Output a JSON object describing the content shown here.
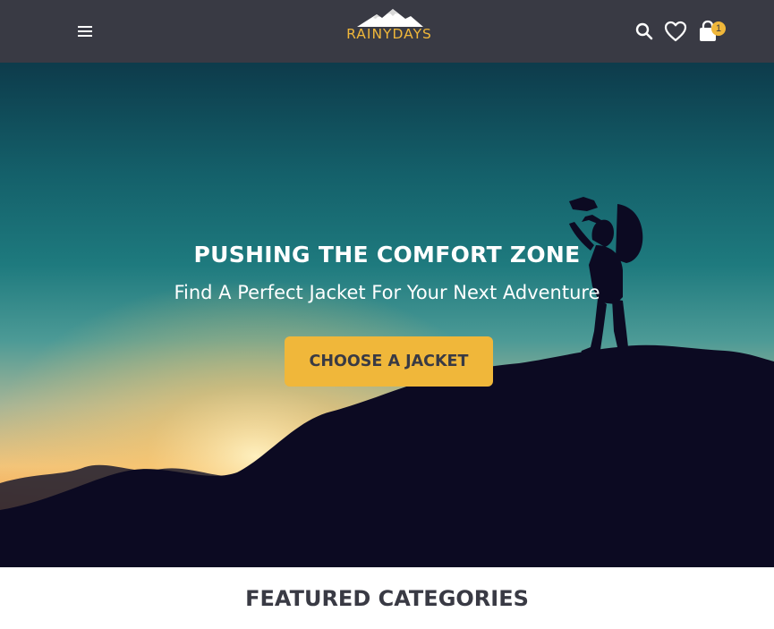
{
  "header": {
    "logo_text": "RAINYDAYS",
    "cart_count": "1"
  },
  "hero": {
    "title": "PUSHING THE COMFORT ZONE",
    "subtitle": "Find A Perfect Jacket For Your Next Adventure",
    "cta_label": "CHOOSE A JACKET"
  },
  "featured": {
    "title": "FEATURED CATEGORIES"
  },
  "colors": {
    "header_bg": "#393a44",
    "accent": "#f0b73a",
    "text_dark": "#393a44",
    "white": "#ffffff"
  },
  "icons": [
    "hamburger-menu-icon",
    "mountain-logo-icon",
    "search-icon",
    "heart-icon",
    "shopping-bag-icon"
  ]
}
